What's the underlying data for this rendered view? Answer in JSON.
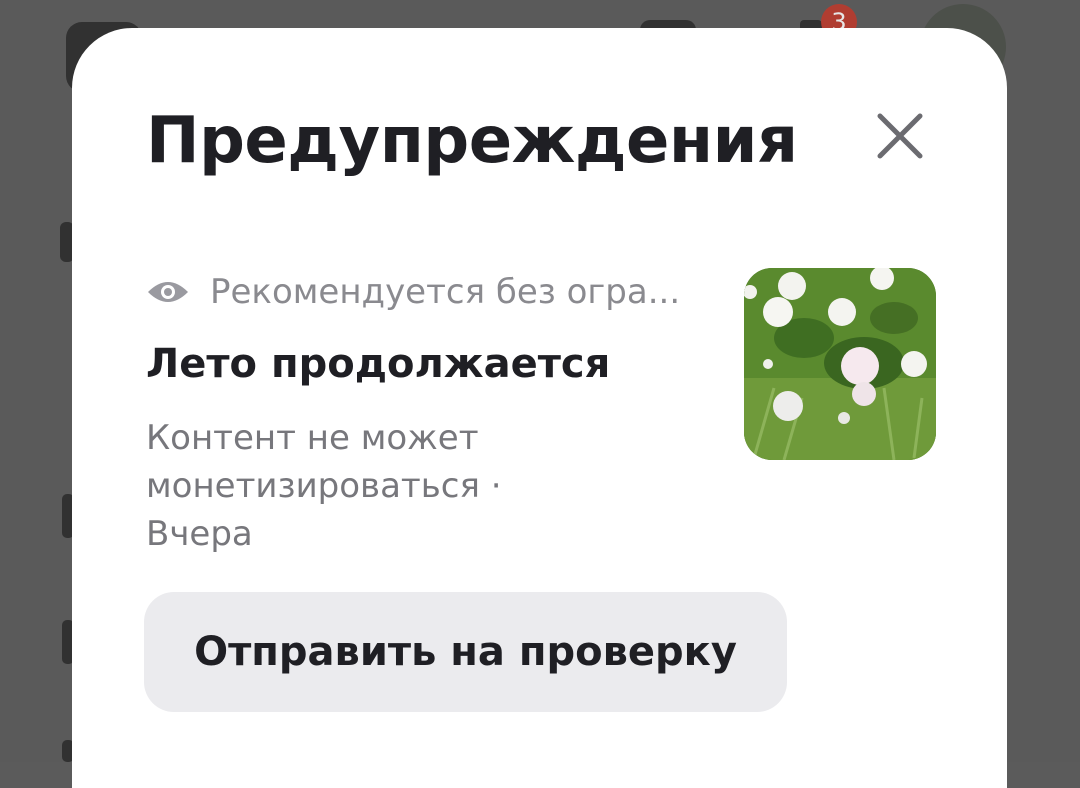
{
  "background": {
    "notification_count": "3"
  },
  "dialog": {
    "title": "Предупреждения",
    "close_icon": "close-icon",
    "warning_item": {
      "visibility_icon": "eye-icon",
      "status": "Рекомендуется без огра...",
      "video_title": "Лето продолжается",
      "meta_line1": "Контент не может",
      "meta_line2": "монетизироваться ·",
      "meta_line3": "Вчера",
      "thumbnail": "white-flowers-thumbnail"
    },
    "review_button_label": "Отправить на проверку"
  },
  "colors": {
    "title_text": "#1f1f24",
    "secondary_text": "#77777c",
    "button_bg": "#ebebee",
    "overlay": "#5a5a5a"
  }
}
